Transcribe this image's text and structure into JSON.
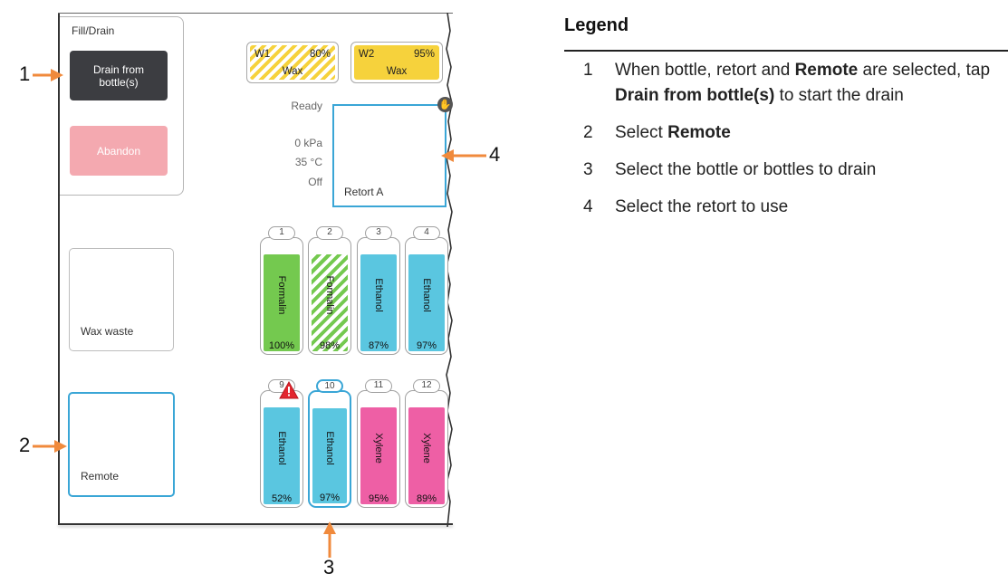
{
  "fill_drain": {
    "title": "Fill/Drain",
    "drain_button_line1": "Drain from",
    "drain_button_line2": "bottle(s)",
    "abandon_button": "Abandon"
  },
  "wax_baths": [
    {
      "name": "W1",
      "percent": "80%",
      "reagent": "Wax",
      "pattern": "hatched"
    },
    {
      "name": "W2",
      "percent": "95%",
      "reagent": "Wax",
      "pattern": "solid"
    }
  ],
  "retort_status": {
    "state": "Ready",
    "pressure": "0 kPa",
    "temperature": "35 °C",
    "stirrer": "Off"
  },
  "retort": {
    "label": "Retort A"
  },
  "targets": {
    "wax_waste": "Wax waste",
    "remote": "Remote"
  },
  "bottles_row1": [
    {
      "number": "1",
      "reagent": "Formalin",
      "percent": "100%",
      "color": "#74c94f",
      "pattern": "solid"
    },
    {
      "number": "2",
      "reagent": "Formalin",
      "percent": "98%",
      "color": "#74c94f",
      "pattern": "hatched"
    },
    {
      "number": "3",
      "reagent": "Ethanol",
      "percent": "87%",
      "color": "#5ac6e0",
      "pattern": "solid"
    },
    {
      "number": "4",
      "reagent": "Ethanol",
      "percent": "97%",
      "color": "#5ac6e0",
      "pattern": "solid"
    }
  ],
  "bottles_row2": [
    {
      "number": "9",
      "reagent": "Ethanol",
      "percent": "52%",
      "color": "#5ac6e0",
      "pattern": "solid"
    },
    {
      "number": "10",
      "reagent": "Ethanol",
      "percent": "97%",
      "color": "#5ac6e0",
      "pattern": "solid"
    },
    {
      "number": "11",
      "reagent": "Xylene",
      "percent": "95%",
      "color": "#ee5fa5",
      "pattern": "solid"
    },
    {
      "number": "12",
      "reagent": "Xylene",
      "percent": "89%",
      "color": "#ee5fa5",
      "pattern": "solid"
    }
  ],
  "callouts": {
    "c1": "1",
    "c2": "2",
    "c3": "3",
    "c4": "4"
  },
  "legend": {
    "title": "Legend",
    "items": [
      {
        "num": "1",
        "t1": "When bottle, retort and ",
        "b1": "Remote",
        "t2": " are selected, tap ",
        "b2": "Drain from bottle(s)",
        "t3": " to start the drain"
      },
      {
        "num": "2",
        "t1": "Select ",
        "b1": "Remote",
        "t2": "",
        "b2": "",
        "t3": ""
      },
      {
        "num": "3",
        "t1": "Select the bottle or bottles to drain",
        "b1": "",
        "t2": "",
        "b2": "",
        "t3": ""
      },
      {
        "num": "4",
        "t1": "Select the retort to use",
        "b1": "",
        "t2": "",
        "b2": "",
        "t3": ""
      }
    ]
  },
  "colors": {
    "accent": "#3aa6d6",
    "arrow": "#f08a3c",
    "wax": "#f6d23c",
    "abandon": "#f4a9b0",
    "drain": "#3c3d41"
  }
}
